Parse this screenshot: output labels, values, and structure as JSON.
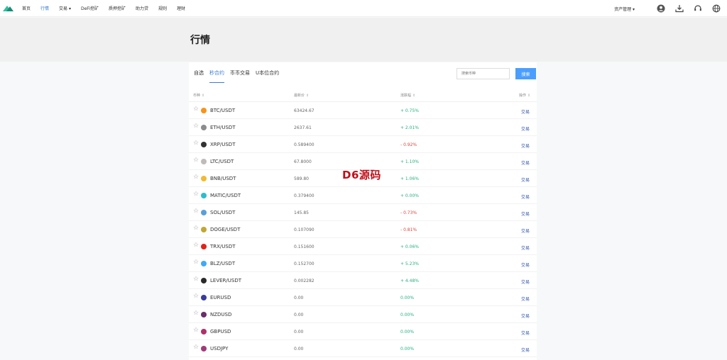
{
  "nav": {
    "items": [
      {
        "label": "首页"
      },
      {
        "label": "行情",
        "active": true
      },
      {
        "label": "交易 ▾"
      },
      {
        "label": "DeFi挖矿"
      },
      {
        "label": "质押挖矿"
      },
      {
        "label": "助力贷"
      },
      {
        "label": "规则"
      },
      {
        "label": "理财"
      }
    ],
    "asset_label": "资产管理 ▾",
    "icons": [
      "user-icon",
      "download-icon",
      "headset-icon",
      "globe-icon"
    ]
  },
  "page": {
    "title": "行情",
    "watermark": "D6源码"
  },
  "tabs": [
    {
      "label": "自选"
    },
    {
      "label": "秒合约",
      "active": true
    },
    {
      "label": "币币交易"
    },
    {
      "label": "U本位合约"
    }
  ],
  "search": {
    "placeholder": "搜索币种",
    "button_label": "搜索"
  },
  "table": {
    "headers": {
      "pair": "币种",
      "price": "最新价",
      "change": "涨跌幅",
      "action": "操作"
    },
    "rows": [
      {
        "symbol": "BTC/USDT",
        "price": "63424.67",
        "change": "+ 0.75%",
        "dir": "up",
        "action": "交易",
        "icon": "btc-icon",
        "color": "#f7931a"
      },
      {
        "symbol": "ETH/USDT",
        "price": "2637.61",
        "change": "+ 2.01%",
        "dir": "up",
        "action": "交易",
        "icon": "eth-icon",
        "color": "#8c8c8c"
      },
      {
        "symbol": "XRP/USDT",
        "price": "0.589400",
        "change": "- 0.92%",
        "dir": "down",
        "action": "交易",
        "icon": "xrp-icon",
        "color": "#333333"
      },
      {
        "symbol": "LTC/USDT",
        "price": "67.8000",
        "change": "+ 1.10%",
        "dir": "up",
        "action": "交易",
        "icon": "ltc-icon",
        "color": "#bfbbbb"
      },
      {
        "symbol": "BNB/USDT",
        "price": "589.80",
        "change": "+ 1.06%",
        "dir": "up",
        "action": "交易",
        "icon": "bnb-icon",
        "color": "#f3ba2f"
      },
      {
        "symbol": "MATIC/USDT",
        "price": "0.379400",
        "change": "+ 0.00%",
        "dir": "up",
        "action": "交易",
        "icon": "matic-icon",
        "color": "#2bbdcc"
      },
      {
        "symbol": "SOL/USDT",
        "price": "145.85",
        "change": "- 0.73%",
        "dir": "down",
        "action": "交易",
        "icon": "sol-icon",
        "color": "#5aa0d8"
      },
      {
        "symbol": "DOGE/USDT",
        "price": "0.107090",
        "change": "- 0.81%",
        "dir": "down",
        "action": "交易",
        "icon": "doge-icon",
        "color": "#c2a633"
      },
      {
        "symbol": "TRX/USDT",
        "price": "0.151600",
        "change": "+ 0.06%",
        "dir": "up",
        "action": "交易",
        "icon": "trx-icon",
        "color": "#e2231a"
      },
      {
        "symbol": "BLZ/USDT",
        "price": "0.152700",
        "change": "+ 5.23%",
        "dir": "up",
        "action": "交易",
        "icon": "blz-icon",
        "color": "#3fa9f5"
      },
      {
        "symbol": "LEVER/USDT",
        "price": "0.002282",
        "change": "+ 4.48%",
        "dir": "up",
        "action": "交易",
        "icon": "lever-icon",
        "color": "#2a2a2a"
      },
      {
        "symbol": "EURUSD",
        "price": "0.00",
        "change": "0.00%",
        "dir": "flat",
        "action": "交易",
        "icon": "eur-flag-icon",
        "color": "#3b3b9c"
      },
      {
        "symbol": "NZDUSD",
        "price": "0.00",
        "change": "0.00%",
        "dir": "flat",
        "action": "交易",
        "icon": "nzd-flag-icon",
        "color": "#6b2d6b"
      },
      {
        "symbol": "GBPUSD",
        "price": "0.00",
        "change": "0.00%",
        "dir": "flat",
        "action": "交易",
        "icon": "gbp-flag-icon",
        "color": "#b0306a"
      },
      {
        "symbol": "USDJPY",
        "price": "0.00",
        "change": "0.00%",
        "dir": "flat",
        "action": "交易",
        "icon": "jpy-flag-icon",
        "color": "#a03a7a"
      }
    ]
  }
}
